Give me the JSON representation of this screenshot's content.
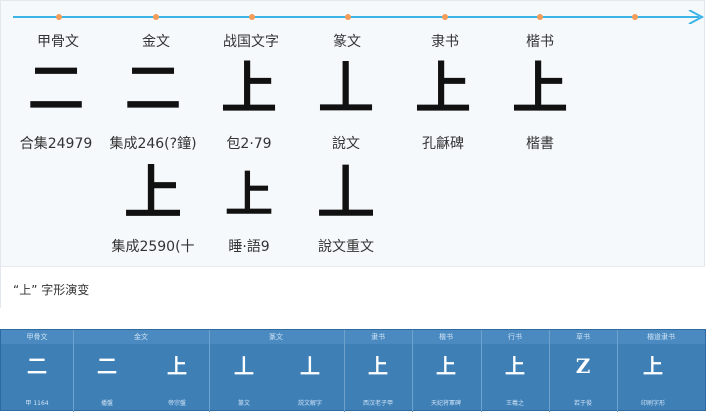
{
  "eras": [
    "甲骨文",
    "金文",
    "战国文字",
    "篆文",
    "隶书",
    "楷书"
  ],
  "row1_sources": [
    "合集24979",
    "集成246(?鐘)",
    "包2·79",
    "說文",
    "孔龢碑",
    "楷書"
  ],
  "row2_sources": [
    "集成2590(十",
    "睡·語9",
    "說文重文"
  ],
  "glyphs": {
    "row1": [
      "二",
      "二",
      "上",
      "丄",
      "上",
      "上"
    ],
    "row2": [
      "上",
      "上",
      "丄"
    ]
  },
  "caption": "“上” 字形演变",
  "table": {
    "headers": [
      "甲骨文",
      "金文",
      "篆文",
      "隶书",
      "楷书",
      "行书",
      "草书",
      "楷道隶书"
    ],
    "glyphs": [
      "二",
      "二",
      "上",
      "丄",
      "丄",
      "上",
      "上",
      "上",
      "Z",
      "上"
    ],
    "footers": [
      "甲 1164",
      "播盤",
      "帝宗盤",
      "篆文",
      "説文解字",
      "西汉老子甲",
      "天纪将軍碑",
      "王羲之",
      "若于俊",
      "印刷字形"
    ]
  },
  "colors": {
    "timeline": "#3cb4e6",
    "dot": "#f39c58",
    "table_bg": "#3e7fb6"
  }
}
